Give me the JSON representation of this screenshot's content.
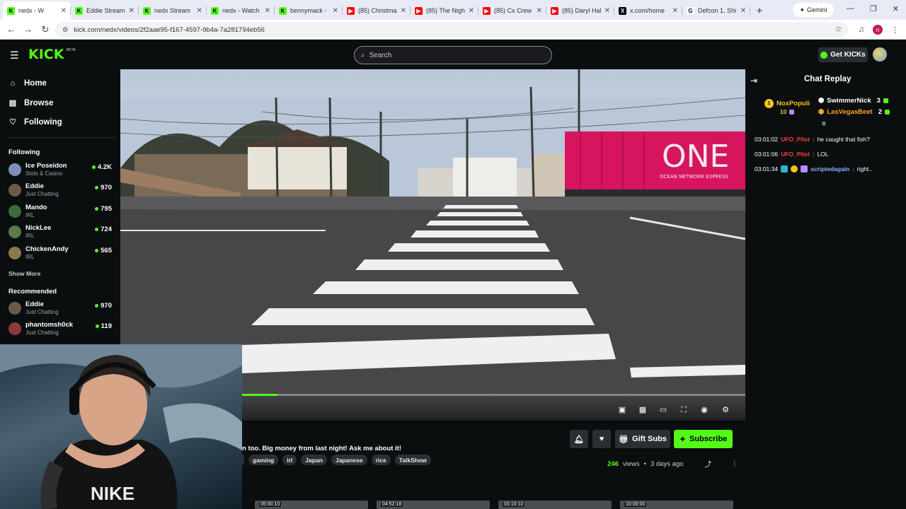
{
  "browser": {
    "tabs": [
      {
        "title": "nedx - W",
        "favicon": "K",
        "color": "#53fc18",
        "active": true
      },
      {
        "title": "Eddie Stream",
        "favicon": "K",
        "color": "#53fc18"
      },
      {
        "title": "nedx Stream",
        "favicon": "K",
        "color": "#53fc18"
      },
      {
        "title": "nedx - Watch",
        "favicon": "K",
        "color": "#53fc18"
      },
      {
        "title": "bennymack -",
        "favicon": "K",
        "color": "#53fc18"
      },
      {
        "title": "(85) Christma",
        "favicon": "▶",
        "color": "#ff0000"
      },
      {
        "title": "(85) The Nigh",
        "favicon": "▶",
        "color": "#ff0000"
      },
      {
        "title": "(85) Cx Crew",
        "favicon": "▶",
        "color": "#ff0000"
      },
      {
        "title": "(85) Daryl Hal",
        "favicon": "▶",
        "color": "#ff0000"
      },
      {
        "title": "x.com/home",
        "favicon": "X",
        "color": "#000000"
      },
      {
        "title": "Defcon 1, Shi",
        "favicon": "G",
        "color": "#ffffff"
      }
    ],
    "gemini_label": "Gemini",
    "url": "kick.com/nedx/videos/2f2aae95-f167-4597-9b4a-7a281794eb56",
    "profile_initial": "n"
  },
  "header": {
    "logo": "KICK",
    "beta": "BETA",
    "search_placeholder": "Search",
    "get_kicks": "Get KICKs",
    "accent": "#53fc18"
  },
  "sidebar": {
    "nav": [
      {
        "label": "Home",
        "icon": "home-icon"
      },
      {
        "label": "Browse",
        "icon": "browse-icon"
      },
      {
        "label": "Following",
        "icon": "heart-icon"
      }
    ],
    "following_heading": "Following",
    "following": [
      {
        "name": "Ice Poseidon",
        "category": "Slots & Casino",
        "viewers": "4.2K"
      },
      {
        "name": "Eddie",
        "category": "Just Chatting",
        "viewers": "970"
      },
      {
        "name": "Mando",
        "category": "IRL",
        "viewers": "795"
      },
      {
        "name": "NickLee",
        "category": "IRL",
        "viewers": "724"
      },
      {
        "name": "ChickenAndy",
        "category": "IRL",
        "viewers": "565"
      }
    ],
    "show_more": "Show More",
    "recommended_heading": "Recommended",
    "recommended": [
      {
        "name": "Eddie",
        "category": "Just Chatting",
        "viewers": "970"
      },
      {
        "name": "phantomsh0ck",
        "category": "Just Chatting",
        "viewers": "119"
      }
    ]
  },
  "video": {
    "progress_fraction": 0.07,
    "title": "n too. Big money from last night! Ask me about it!",
    "tags": [
      "",
      "gaming",
      "irl",
      "Japan",
      "Japanese",
      "rice",
      "TalkShow"
    ],
    "views": "246",
    "views_label": "views",
    "posted": "3 days ago",
    "gift_subs": "Gift Subs",
    "subscribe": "Subscribe",
    "truck_text": "ONE",
    "truck_subtext": "OCEAN NETWORK EXPRESS",
    "thumb_times": [
      "05:00:10",
      "04:52:18",
      "03:10:10",
      "10:00:00"
    ]
  },
  "chat": {
    "title": "Chat Replay",
    "leaders": [
      {
        "rank": "1",
        "name": "NoxPopuli",
        "count": "10"
      },
      {
        "name": "SwimmerNick",
        "count": "3"
      },
      {
        "name": "LasVegasBeet",
        "count": "2"
      }
    ],
    "messages": [
      {
        "time": "03:01:02",
        "user": "UFO_Pilot",
        "user_color": "#ff3b3b",
        "text": "he caught that fish?"
      },
      {
        "time": "03:01:06",
        "user": "UFO_Pilot",
        "user_color": "#ff3b3b",
        "text": "LOL"
      },
      {
        "time": "03:01:34",
        "user": "scriptedagain",
        "user_color": "#8ab4ff",
        "text": "right.."
      }
    ]
  }
}
